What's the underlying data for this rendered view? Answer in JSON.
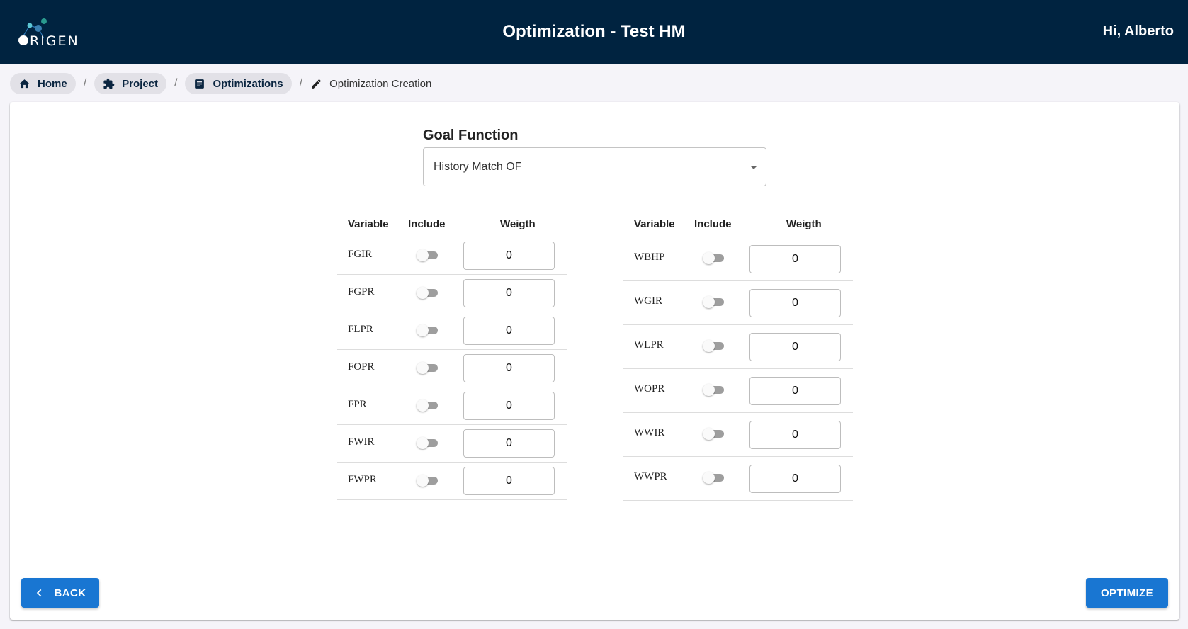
{
  "header": {
    "logo_text": "ORIGEN",
    "title": "Optimization - Test HM",
    "greeting": "Hi, Alberto"
  },
  "breadcrumb": {
    "items": [
      {
        "label": "Home",
        "icon": "home-icon"
      },
      {
        "label": "Project",
        "icon": "puzzle-icon"
      },
      {
        "label": "Optimizations",
        "icon": "document-icon"
      }
    ],
    "separator": "/",
    "current": {
      "label": "Optimization Creation",
      "icon": "pencil-icon"
    }
  },
  "goal_function": {
    "label": "Goal Function",
    "selected": "History Match OF"
  },
  "table_headers": {
    "variable": "Variable",
    "include": "Include",
    "weight": "Weigth"
  },
  "left_table": {
    "rows": [
      {
        "variable": "FGIR",
        "include": false,
        "weight": "0"
      },
      {
        "variable": "FGPR",
        "include": false,
        "weight": "0"
      },
      {
        "variable": "FLPR",
        "include": false,
        "weight": "0"
      },
      {
        "variable": "FOPR",
        "include": false,
        "weight": "0"
      },
      {
        "variable": "FPR",
        "include": false,
        "weight": "0"
      },
      {
        "variable": "FWIR",
        "include": false,
        "weight": "0"
      },
      {
        "variable": "FWPR",
        "include": false,
        "weight": "0"
      }
    ]
  },
  "right_table": {
    "rows": [
      {
        "variable": "WBHP",
        "include": false,
        "weight": "0"
      },
      {
        "variable": "WGIR",
        "include": false,
        "weight": "0"
      },
      {
        "variable": "WLPR",
        "include": false,
        "weight": "0"
      },
      {
        "variable": "WOPR",
        "include": false,
        "weight": "0"
      },
      {
        "variable": "WWIR",
        "include": false,
        "weight": "0"
      },
      {
        "variable": "WWPR",
        "include": false,
        "weight": "0"
      }
    ]
  },
  "actions": {
    "back_label": "BACK",
    "optimize_label": "OPTIMIZE"
  },
  "colors": {
    "header_bg": "#002340",
    "primary": "#1976d2",
    "page_bg": "#f5f4f9"
  }
}
